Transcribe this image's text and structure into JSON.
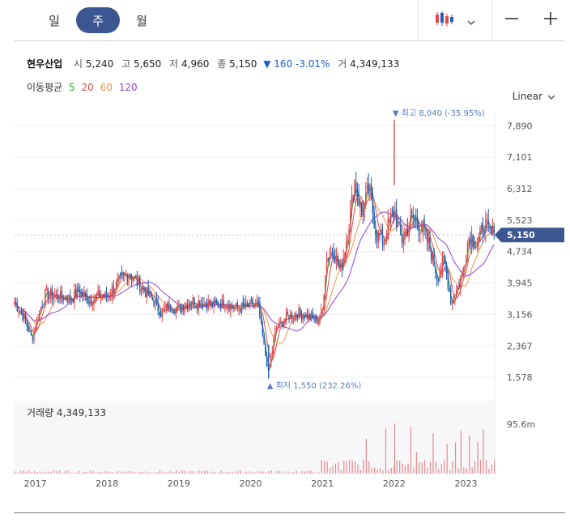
{
  "tabs": [
    "일",
    "주",
    "월"
  ],
  "active_tab": 1,
  "stock": {
    "name": "현우산업",
    "open_label": "시",
    "open": "5,240",
    "high_label": "고",
    "high": "5,650",
    "low_label": "저",
    "low": "4,960",
    "close_label": "종",
    "close": "5,150",
    "change": "▼ 160 -3.01%",
    "volume_label": "거",
    "volume": "4,349,133"
  },
  "ma_legend": {
    "label": "이동평균",
    "items": [
      {
        "label": "5",
        "color": "#2ca02c"
      },
      {
        "label": "20",
        "color": "#e2474b"
      },
      {
        "label": "60",
        "color": "#f5913d"
      },
      {
        "label": "120",
        "color": "#8c3fdc"
      }
    ]
  },
  "scale_label": "Linear",
  "volume_title": "거래량 4,349,133",
  "colors": {
    "up": "#e2474b",
    "down": "#1f5fb7",
    "accent": "#3b5690"
  },
  "icons": {
    "chart_type": "candlestick-icon",
    "dropdown": "chevron-down-icon",
    "zoom_out": "minus-icon",
    "zoom_in": "plus-icon"
  },
  "chart_data": {
    "type": "candlestick",
    "title": "",
    "xlabel": "",
    "ylabel": "",
    "x_ticks": [
      "2017",
      "2018",
      "2019",
      "2020",
      "2021",
      "2022",
      "2023"
    ],
    "y_ticks": [
      "7,890",
      "7,101",
      "6,312",
      "5,523",
      "4,734",
      "3,945",
      "3,156",
      "2,367",
      "1,578"
    ],
    "y_tick_values": [
      7890,
      7101,
      6312,
      5523,
      4734,
      3945,
      3156,
      2367,
      1578
    ],
    "ylim": [
      1500,
      8200
    ],
    "x_range": [
      2016.7,
      2023.4
    ],
    "current_price": 5150,
    "current_price_label": "5,150",
    "max_annotation": {
      "label": "최고 8,040 (-35.95%)",
      "value": 8040,
      "x": 2022.0
    },
    "min_annotation": {
      "label": "최저 1,550 (232.26%)",
      "value": 1550,
      "x": 2020.25
    },
    "volume_axis_label": "95.6m",
    "volume_axis_value": 95600000,
    "close_path": [
      [
        2016.7,
        3500
      ],
      [
        2016.85,
        3050
      ],
      [
        2016.95,
        2550
      ],
      [
        2017.05,
        3200
      ],
      [
        2017.15,
        3700
      ],
      [
        2017.3,
        3600
      ],
      [
        2017.5,
        3550
      ],
      [
        2017.6,
        3750
      ],
      [
        2017.75,
        3500
      ],
      [
        2017.9,
        3650
      ],
      [
        2018.0,
        3600
      ],
      [
        2018.15,
        3950
      ],
      [
        2018.3,
        4200
      ],
      [
        2018.4,
        4000
      ],
      [
        2018.55,
        3700
      ],
      [
        2018.65,
        3500
      ],
      [
        2018.75,
        3200
      ],
      [
        2018.85,
        3350
      ],
      [
        2019.0,
        3300
      ],
      [
        2019.15,
        3500
      ],
      [
        2019.3,
        3450
      ],
      [
        2019.5,
        3400
      ],
      [
        2019.65,
        3450
      ],
      [
        2019.8,
        3300
      ],
      [
        2019.95,
        3350
      ],
      [
        2020.1,
        3400
      ],
      [
        2020.2,
        2200
      ],
      [
        2020.25,
        1700
      ],
      [
        2020.35,
        2800
      ],
      [
        2020.5,
        3100
      ],
      [
        2020.65,
        3200
      ],
      [
        2020.8,
        3100
      ],
      [
        2020.95,
        3000
      ],
      [
        2021.0,
        3250
      ],
      [
        2021.05,
        4500
      ],
      [
        2021.15,
        4800
      ],
      [
        2021.25,
        4200
      ],
      [
        2021.35,
        5200
      ],
      [
        2021.45,
        6500
      ],
      [
        2021.55,
        5700
      ],
      [
        2021.65,
        6300
      ],
      [
        2021.75,
        5200
      ],
      [
        2021.85,
        5000
      ],
      [
        2022.0,
        5800
      ],
      [
        2022.1,
        5000
      ],
      [
        2022.25,
        5600
      ],
      [
        2022.4,
        5300
      ],
      [
        2022.5,
        4800
      ],
      [
        2022.6,
        4100
      ],
      [
        2022.7,
        4500
      ],
      [
        2022.8,
        3400
      ],
      [
        2022.95,
        4200
      ],
      [
        2023.05,
        5200
      ],
      [
        2023.15,
        4900
      ],
      [
        2023.25,
        5400
      ],
      [
        2023.35,
        5150
      ]
    ],
    "ma_series": [
      {
        "name": "5",
        "color": "#2ca02c",
        "smooth": 2
      },
      {
        "name": "20",
        "color": "#e2474b",
        "smooth": 5
      },
      {
        "name": "60",
        "color": "#f5913d",
        "smooth": 13
      },
      {
        "name": "120",
        "color": "#8c3fdc",
        "smooth": 26
      }
    ]
  }
}
